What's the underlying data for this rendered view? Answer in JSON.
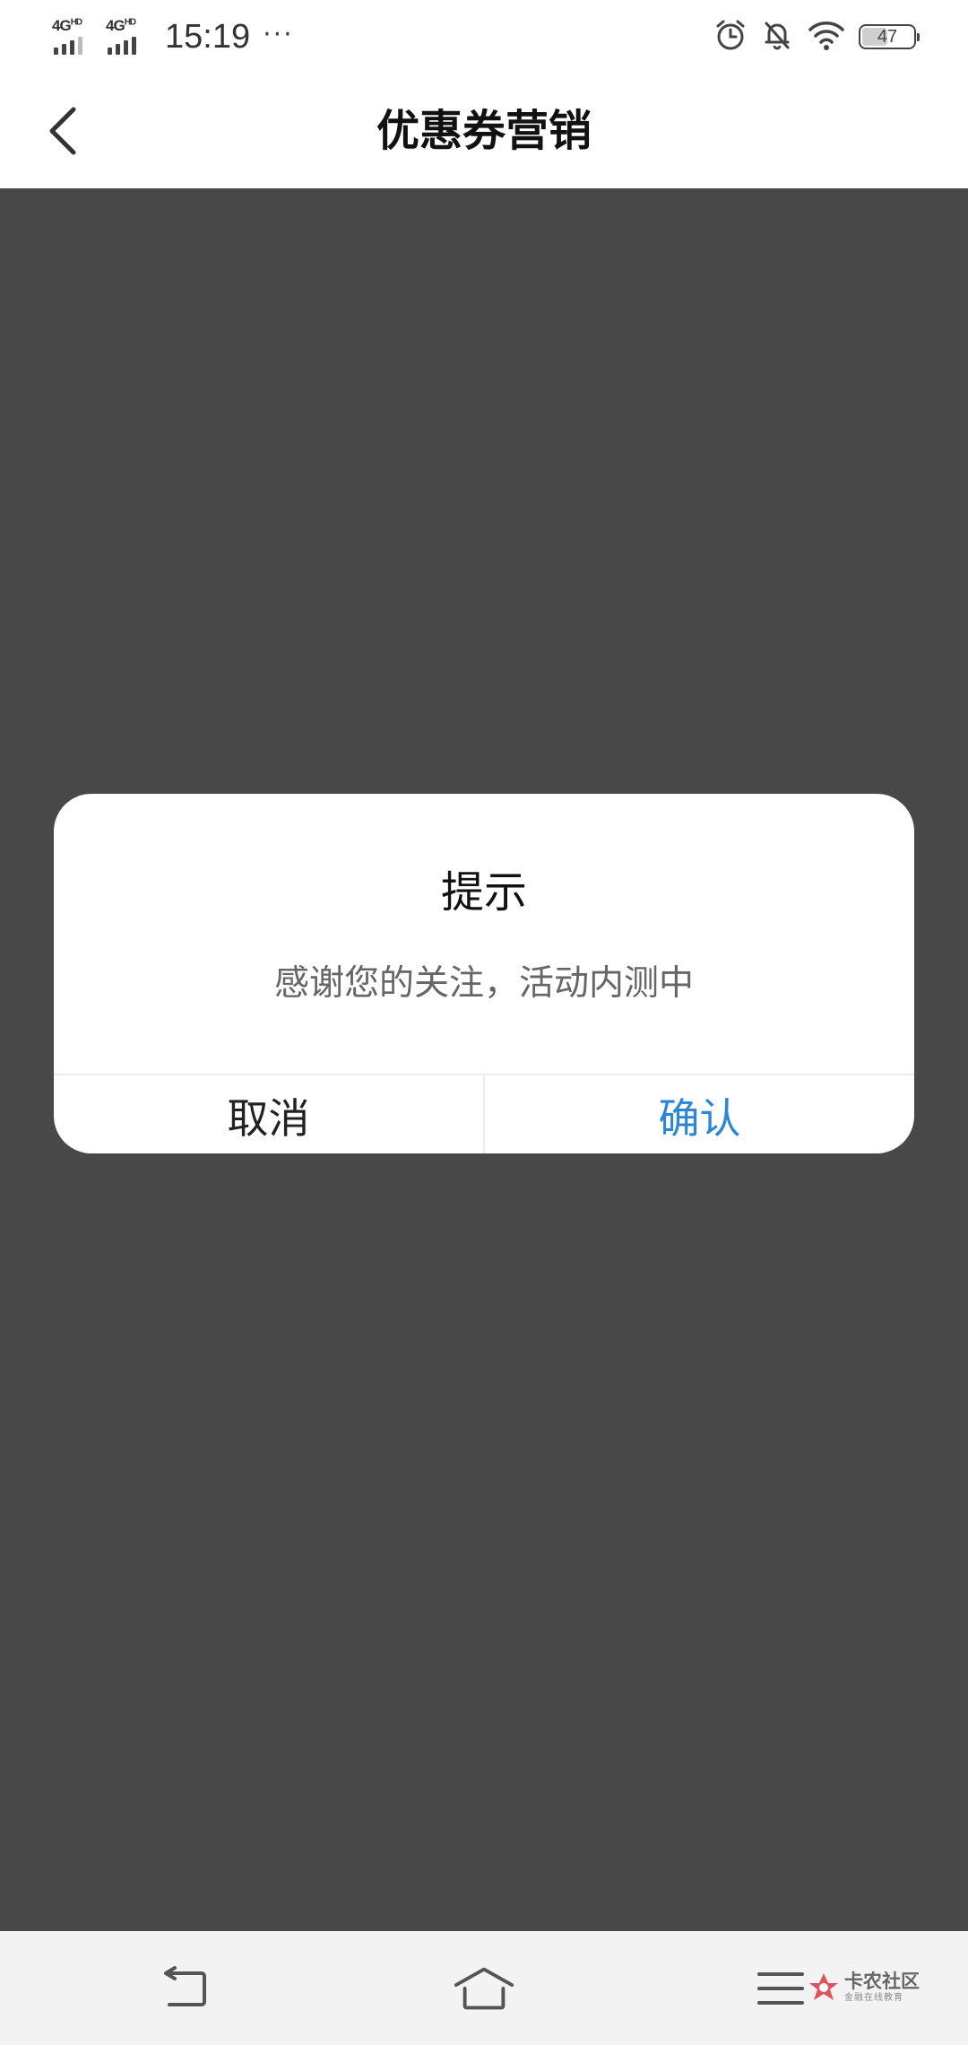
{
  "status_bar": {
    "sim1_network": "4G",
    "sim1_tag": "HD",
    "sim2_network": "4G",
    "sim2_tag": "HD",
    "time": "15:19",
    "more": "···",
    "battery_level": "47"
  },
  "header": {
    "title": "优惠券营销"
  },
  "dialog": {
    "title": "提示",
    "message": "感谢您的关注，活动内测中",
    "cancel_label": "取消",
    "confirm_label": "确认"
  },
  "watermark": {
    "name": "卡农社区",
    "subtitle": "金融在线教育"
  },
  "colors": {
    "overlay": "#484848",
    "confirm_accent": "#2a86d6",
    "watermark_logo": "#e0525d"
  }
}
